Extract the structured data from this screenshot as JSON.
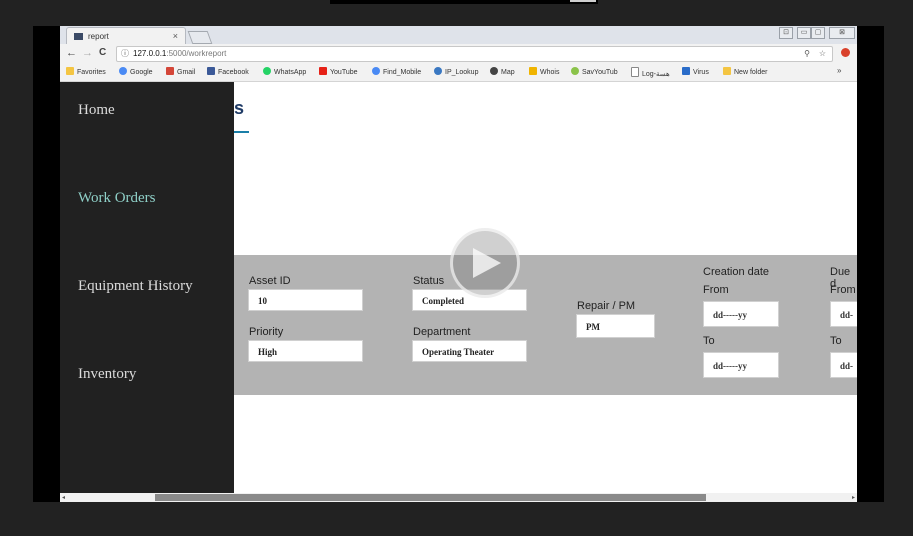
{
  "tab": {
    "title": "report",
    "close": "×"
  },
  "window_controls": [
    "⊡",
    "▭",
    "▢",
    "⊠"
  ],
  "nav": {
    "back": "←",
    "forward": "→",
    "reload": "C"
  },
  "address": {
    "info_icon": "ⓘ",
    "host": "127.0.0.1",
    "path": ":5000/workreport",
    "zoom": "⚲",
    "star": "☆"
  },
  "bookmarks": {
    "items": [
      {
        "label": "Favorites",
        "color": "#f4c542"
      },
      {
        "label": "Google",
        "color": "#4a8af4"
      },
      {
        "label": "Gmail",
        "color": "#d44638"
      },
      {
        "label": "Facebook",
        "color": "#3b5998"
      },
      {
        "label": "WhatsApp",
        "color": "#25d366"
      },
      {
        "label": "YouTube",
        "color": "#e62117"
      },
      {
        "label": "Find_Mobile",
        "color": "#4a8af4"
      },
      {
        "label": "IP_Lookup",
        "color": "#3a78c2"
      },
      {
        "label": "Map",
        "color": "#444444"
      },
      {
        "label": "Whois",
        "color": "#f0b400"
      },
      {
        "label": "SavYouTub",
        "color": "#8bc34a"
      },
      {
        "label": "Log-هسة",
        "color": "#888888"
      },
      {
        "label": "Virus",
        "color": "#2a6cc9"
      },
      {
        "label": "New folder",
        "color": "#f4c542"
      }
    ],
    "more": "»"
  },
  "sidebar": {
    "items": [
      {
        "label": "Home"
      },
      {
        "label": "Work Orders"
      },
      {
        "label": "Equipment History"
      },
      {
        "label": "Inventory"
      }
    ]
  },
  "page": {
    "heading": "s"
  },
  "filters": {
    "asset_id": {
      "label": "Asset ID",
      "value": "10"
    },
    "priority": {
      "label": "Priority",
      "value": "High"
    },
    "status": {
      "label": "Status",
      "value": "Completed"
    },
    "department": {
      "label": "Department",
      "value": "Operating Theater"
    },
    "repair_pm": {
      "label": "Repair / PM",
      "value": "PM"
    },
    "creation_date": {
      "label": "Creation date",
      "from_label": "From",
      "from_value": "dd-----yy",
      "to_label": "To",
      "to_value": "dd-----yy"
    },
    "due_date": {
      "label": "Due d",
      "from_label": "From",
      "from_value": "dd-",
      "to_label": "To",
      "to_value": "dd-"
    }
  },
  "colors": {
    "sidebar_bg": "#212121",
    "active_nav": "#8fd0c8",
    "filter_bg": "#b3b3b3",
    "heading": "#1f3b66",
    "accent": "#1a7fa8"
  }
}
